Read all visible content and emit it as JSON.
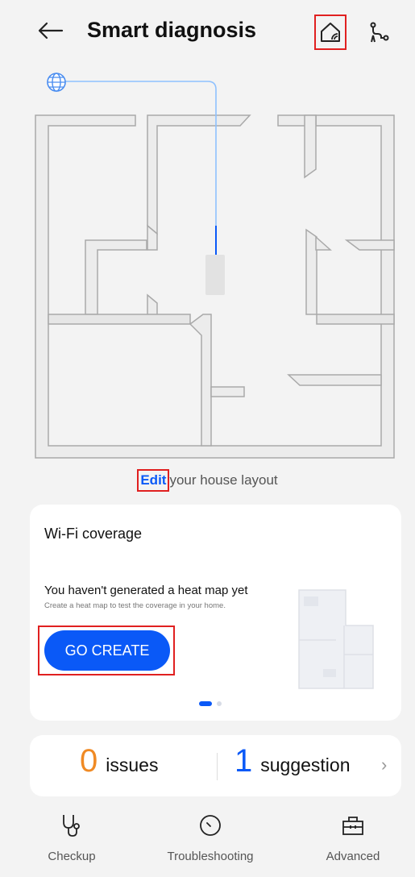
{
  "header": {
    "title": "Smart diagnosis",
    "back_icon": "arrow-left-icon",
    "home_icon": "home-wifi-icon",
    "route_icon": "route-icon"
  },
  "floorplan": {
    "globe_icon": "globe-icon"
  },
  "edit": {
    "link": "Edit",
    "rest": "your house layout"
  },
  "coverage_card": {
    "title": "Wi-Fi coverage",
    "message": "You haven't generated a heat map yet",
    "subtext": "Create a heat map to test the coverage in your home.",
    "button": "GO CREATE",
    "page_count": 2,
    "active_page": 1
  },
  "summary": {
    "issues_count": "0",
    "issues_label": "issues",
    "suggestion_count": "1",
    "suggestion_label": "suggestion",
    "chevron": "›"
  },
  "tabs": [
    {
      "label": "Checkup",
      "icon": "stethoscope-icon"
    },
    {
      "label": "Troubleshooting",
      "icon": "speedometer-icon"
    },
    {
      "label": "Advanced",
      "icon": "toolbox-icon"
    }
  ],
  "colors": {
    "accent": "#0a59f7",
    "issues": "#f08a24",
    "highlight_box": "#e02020",
    "background": "#f3f3f3"
  }
}
